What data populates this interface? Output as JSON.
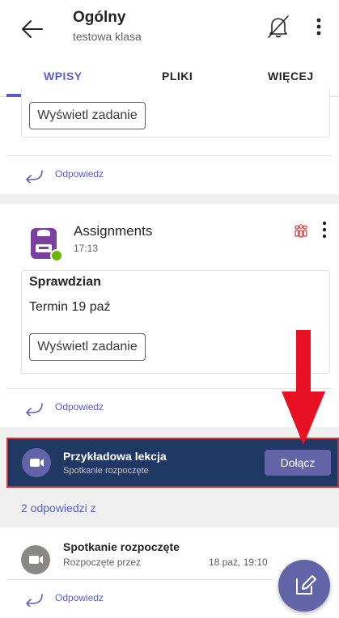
{
  "header": {
    "title": "Ogólny",
    "subtitle": "testowa klasa"
  },
  "tabs": [
    {
      "label": "WPISY",
      "active": true
    },
    {
      "label": "PLIKI",
      "active": false
    },
    {
      "label": "WIĘCEJ",
      "active": false
    }
  ],
  "post1": {
    "view_task_label": "Wyświetl zadanie",
    "reply_label": "Odpowiedz"
  },
  "post2": {
    "app_name": "Assignments",
    "time": "17:13",
    "card_heading": "Sprawdzian",
    "card_due": "Termin 19 paź",
    "view_task_label": "Wyświetl zadanie",
    "reply_label": "Odpowiedz"
  },
  "meeting_banner": {
    "title": "Przykładowa lekcja",
    "subtitle": "Spotkanie rozpoczęte",
    "join_label": "Dołącz"
  },
  "meeting_post": {
    "replies_count": "2 odpowiedzi z",
    "title": "Spotkanie rozpoczęte",
    "subtitle": "Rozpoczęte przez",
    "timestamp": "18 paź, 19:10",
    "reply_label": "Odpowiedz"
  },
  "icons": {
    "back": "back-arrow-icon",
    "notifications": "bell-off-icon",
    "menu": "more-vertical-icon",
    "reply": "reply-arrow-icon",
    "assignments_app": "assignments-app-icon",
    "team": "team-icon",
    "camera": "video-camera-icon",
    "compose": "compose-icon"
  },
  "colors": {
    "accent": "#5b5fc7",
    "banner_bg": "#1f3864",
    "join_bg": "#6264a7",
    "annotation_red": "#e81123"
  }
}
